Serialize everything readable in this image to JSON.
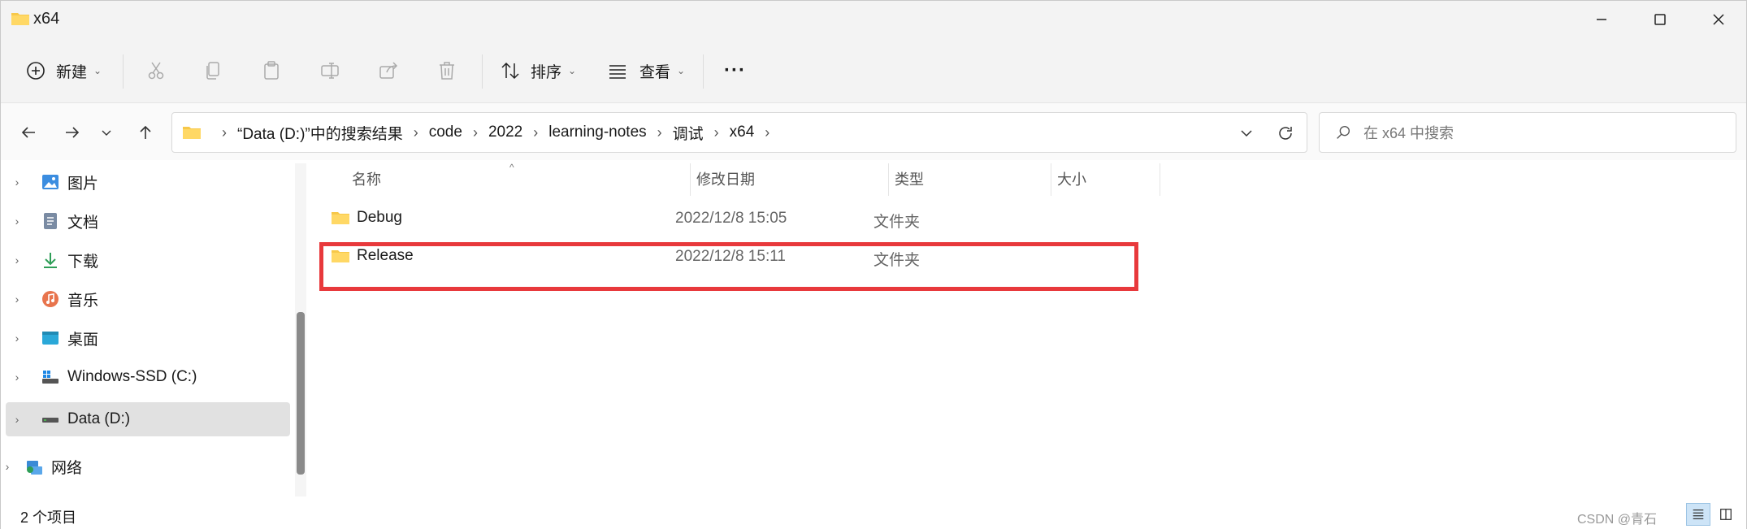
{
  "window": {
    "title": "x64"
  },
  "toolbar": {
    "new_label": "新建",
    "sort_label": "排序",
    "view_label": "查看",
    "more_label": "···"
  },
  "address": {
    "crumbs": [
      "“Data (D:)”中的搜索结果",
      "code",
      "2022",
      "learning-notes",
      "调试",
      "x64"
    ],
    "search_placeholder": "在 x64 中搜索"
  },
  "sidebar": {
    "items": [
      {
        "label": "图片",
        "icon": "pictures-icon"
      },
      {
        "label": "文档",
        "icon": "documents-icon"
      },
      {
        "label": "下载",
        "icon": "downloads-icon"
      },
      {
        "label": "音乐",
        "icon": "music-icon"
      },
      {
        "label": "桌面",
        "icon": "desktop-icon"
      },
      {
        "label": "Windows-SSD (C:)",
        "icon": "drive-c-icon"
      },
      {
        "label": "Data (D:)",
        "icon": "drive-d-icon"
      },
      {
        "label": "网络",
        "icon": "network-icon"
      }
    ]
  },
  "columns": {
    "name": "名称",
    "modified": "修改日期",
    "type": "类型",
    "size": "大小"
  },
  "files": [
    {
      "name": "Debug",
      "modified": "2022/12/8 15:05",
      "type": "文件夹"
    },
    {
      "name": "Release",
      "modified": "2022/12/8 15:11",
      "type": "文件夹"
    }
  ],
  "status": {
    "count": "2 个项目"
  },
  "watermark": "CSDN @青石"
}
